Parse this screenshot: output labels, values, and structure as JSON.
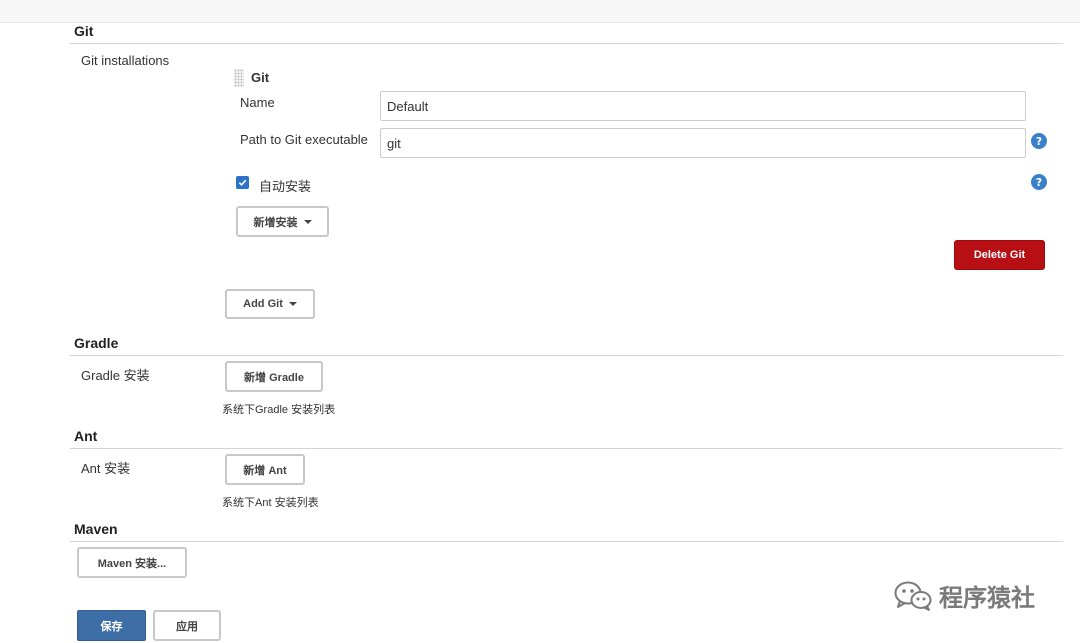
{
  "git": {
    "section_title": "Git",
    "installations_label": "Git installations",
    "block_title": "Git",
    "name_label": "Name",
    "name_value": "Default",
    "path_label": "Path to Git executable",
    "path_value": "git",
    "auto_install_label": "自动安装",
    "auto_install_checked": true,
    "add_installer_label": "新增安装",
    "delete_label": "Delete Git",
    "add_git_label": "Add Git"
  },
  "gradle": {
    "section_title": "Gradle",
    "installations_label": "Gradle 安装",
    "add_button_label": "新增 Gradle",
    "description": "系统下Gradle 安装列表"
  },
  "ant": {
    "section_title": "Ant",
    "installations_label": "Ant 安装",
    "add_button_label": "新增 Ant",
    "description": "系统下Ant 安装列表"
  },
  "maven": {
    "section_title": "Maven",
    "installations_button_label": "Maven 安装..."
  },
  "footer": {
    "save_label": "保存",
    "apply_label": "应用"
  },
  "watermark": {
    "text": "程序猿社",
    "icon": "wechat-icon"
  },
  "help_glyph": "?",
  "colors": {
    "primary": "#3e6ea6",
    "danger": "#b70f14",
    "help": "#3a7fc9",
    "checkbox": "#2b74c9"
  }
}
